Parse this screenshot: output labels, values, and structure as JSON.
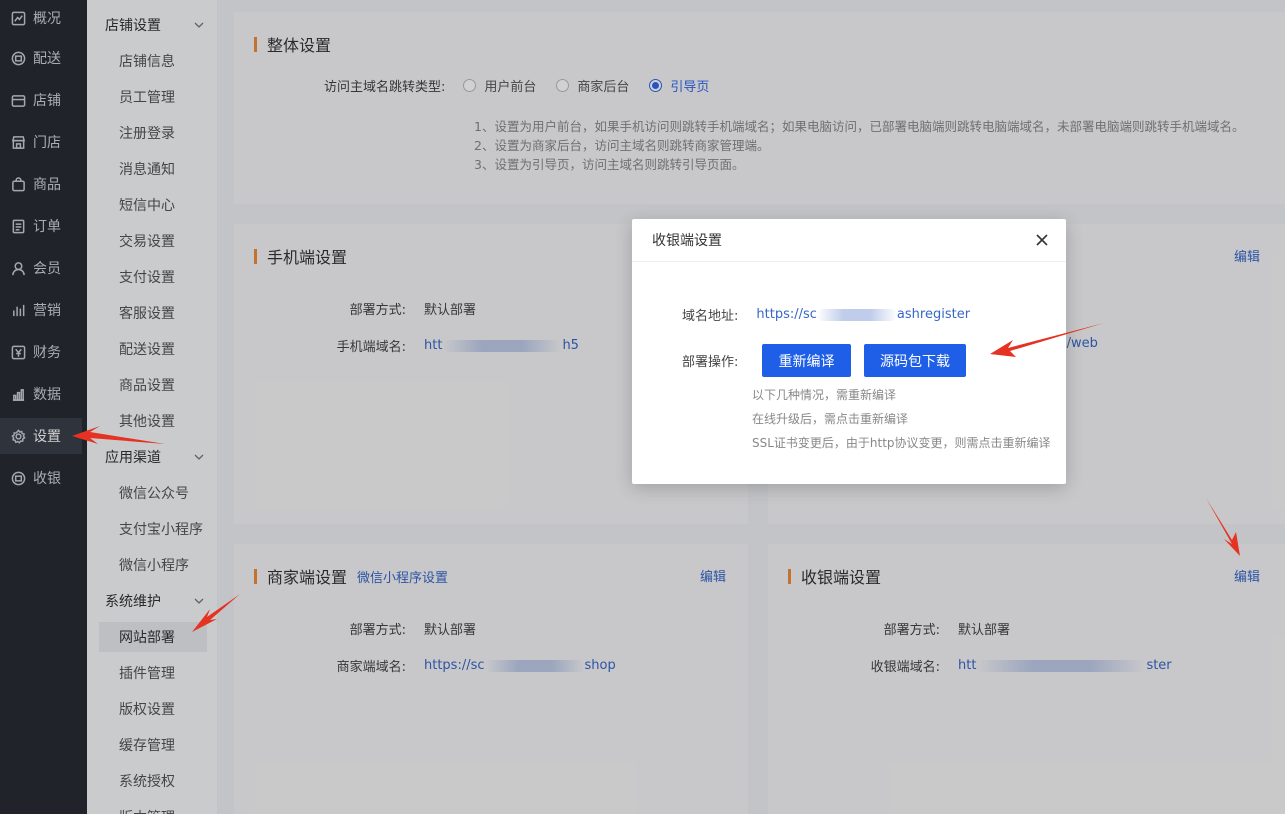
{
  "nav": {
    "items": [
      {
        "label": "概况",
        "icon": "chart-line-icon"
      },
      {
        "label": "配送",
        "icon": "delivery-icon"
      },
      {
        "label": "店铺",
        "icon": "store-icon"
      },
      {
        "label": "门店",
        "icon": "shop-icon"
      },
      {
        "label": "商品",
        "icon": "bag-icon"
      },
      {
        "label": "订单",
        "icon": "order-icon"
      },
      {
        "label": "会员",
        "icon": "user-icon"
      },
      {
        "label": "营销",
        "icon": "bar-chart-icon"
      },
      {
        "label": "财务",
        "icon": "finance-icon"
      },
      {
        "label": "数据",
        "icon": "data-icon"
      },
      {
        "label": "设置",
        "icon": "gear-icon"
      },
      {
        "label": "收银",
        "icon": "cashier-icon"
      }
    ],
    "active": "设置"
  },
  "submenu": {
    "groups": [
      {
        "title": "店铺设置",
        "items": [
          "店铺信息",
          "员工管理",
          "注册登录",
          "消息通知",
          "短信中心",
          "交易设置",
          "支付设置",
          "客服设置",
          "配送设置",
          "商品设置",
          "其他设置"
        ]
      },
      {
        "title": "应用渠道",
        "items": [
          "微信公众号",
          "支付宝小程序",
          "微信小程序"
        ]
      },
      {
        "title": "系统维护",
        "items": [
          "网站部署",
          "插件管理",
          "版权设置",
          "缓存管理",
          "系统授权",
          "版本管理"
        ]
      }
    ],
    "active": "网站部署"
  },
  "overall": {
    "title": "整体设置",
    "jump_label": "访问主域名跳转类型:",
    "options": [
      "用户前台",
      "商家后台",
      "引导页"
    ],
    "selected": "引导页",
    "notes": [
      "1、设置为用户前台，如果手机访问则跳转手机端域名；如果电脑访问，已部署电脑端则跳转电脑端域名，未部署电脑端则跳转手机端域名。",
      "2、设置为商家后台，访问主域名则跳转商家管理端。",
      "3、设置为引导页，访问主域名则跳转引导页面。"
    ]
  },
  "mobile": {
    "title": "手机端设置",
    "deploy_label": "部署方式:",
    "deploy_value": "默认部署",
    "domain_label": "手机端域名:",
    "domain_value_start": "htt",
    "domain_value_end": "h5"
  },
  "pc": {
    "edit": "编辑",
    "domain_value_end": "m/web"
  },
  "merchant": {
    "title": "商家端设置",
    "mini_link": "微信小程序设置",
    "edit": "编辑",
    "deploy_label": "部署方式:",
    "deploy_value": "默认部署",
    "domain_label": "商家端域名:",
    "domain_value_start": "https://sc",
    "domain_value_end": "shop"
  },
  "cashier": {
    "title": "收银端设置",
    "edit": "编辑",
    "deploy_label": "部署方式:",
    "deploy_value": "默认部署",
    "domain_label": "收银端域名:",
    "domain_value_start": "htt",
    "domain_value_end": "ster"
  },
  "modal": {
    "title": "收银端设置",
    "domain_label": "域名地址:",
    "domain_value_start": "https://sc",
    "domain_value_end": "ashregister",
    "op_label": "部署操作:",
    "rebuild_btn": "重新编译",
    "download_btn": "源码包下载",
    "notes": [
      "以下几种情况，需重新编译",
      "在线升级后，需点击重新编译",
      "SSL证书变更后，由于http协议变更，则需点击重新编译"
    ]
  },
  "colors": {
    "accent": "#1f5fe8",
    "link": "#3767c9",
    "title_bar": "#ef8b3c",
    "arrow": "#e53222",
    "nav_bg": "#282c34"
  }
}
